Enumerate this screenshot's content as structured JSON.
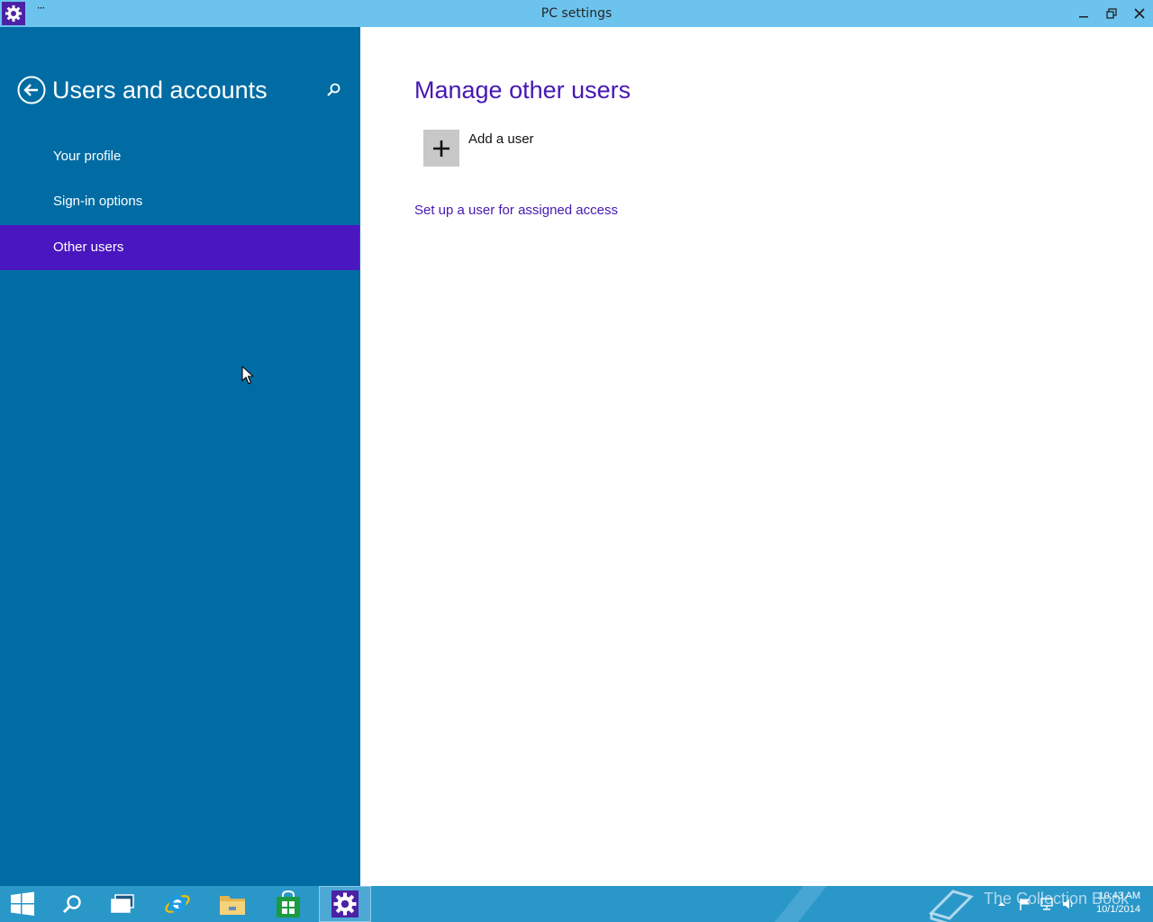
{
  "window": {
    "title": "PC settings",
    "menu_glyph": "···",
    "icons": {
      "app": "gear-icon",
      "minimize": "minimize-icon",
      "maximize": "restore-icon",
      "close": "close-icon"
    }
  },
  "sidebar": {
    "title": "Users and accounts",
    "icons": {
      "back": "back-arrow-icon",
      "search": "search-icon"
    },
    "items": [
      {
        "label": "Your profile",
        "active": false
      },
      {
        "label": "Sign-in options",
        "active": false
      },
      {
        "label": "Other users",
        "active": true
      }
    ]
  },
  "main": {
    "title": "Manage other users",
    "add_user_label": "Add a user",
    "assigned_access_link": "Set up a user for assigned access",
    "icons": {
      "add": "plus-icon"
    }
  },
  "taskbar": {
    "apps": [
      "start",
      "search",
      "task-view",
      "internet-explorer",
      "file-explorer",
      "store",
      "pc-settings"
    ],
    "active_app": "pc-settings",
    "watermark": "The Collection Book",
    "clock": {
      "time": "10:43 AM",
      "date": "10/1/2014"
    }
  },
  "colors": {
    "titlebar": "#6cc3ee",
    "sidebar": "#016ca4",
    "accent": "#4a16c0",
    "heading": "#4617b4",
    "taskbar": "#2a97c9"
  }
}
